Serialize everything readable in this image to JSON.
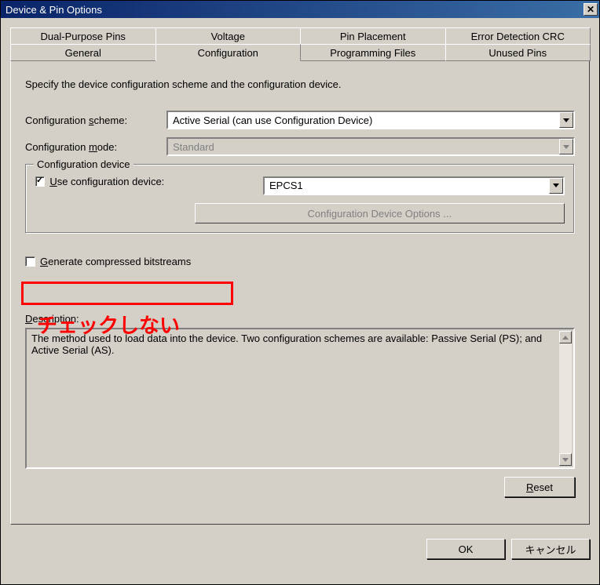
{
  "window": {
    "title": "Device & Pin Options"
  },
  "tabs_row1": [
    {
      "label": "Dual-Purpose Pins"
    },
    {
      "label": "Voltage"
    },
    {
      "label": "Pin Placement"
    },
    {
      "label": "Error Detection CRC"
    }
  ],
  "tabs_row2": [
    {
      "label": "General"
    },
    {
      "label": "Configuration"
    },
    {
      "label": "Programming Files"
    },
    {
      "label": "Unused Pins"
    }
  ],
  "panel": {
    "instruction": "Specify the device configuration scheme and the configuration device.",
    "scheme_label": "Configuration scheme:",
    "scheme_value": "Active Serial (can use Configuration Device)",
    "mode_label": "Configuration mode:",
    "mode_value": "Standard",
    "group_title": "Configuration device",
    "use_cfg_label": "Use configuration device:",
    "device_value": "EPCS1",
    "device_opts_btn": "Configuration Device Options ...",
    "gen_compressed_label": "Generate compressed bitstreams",
    "desc_label": "Description:",
    "desc_text": "The method used to load data into the device. Two configuration schemes are available: Passive Serial (PS); and Active Serial (AS).",
    "reset": "Reset"
  },
  "buttons": {
    "ok": "OK",
    "cancel": "キャンセル"
  },
  "annotation": "チェックしない"
}
